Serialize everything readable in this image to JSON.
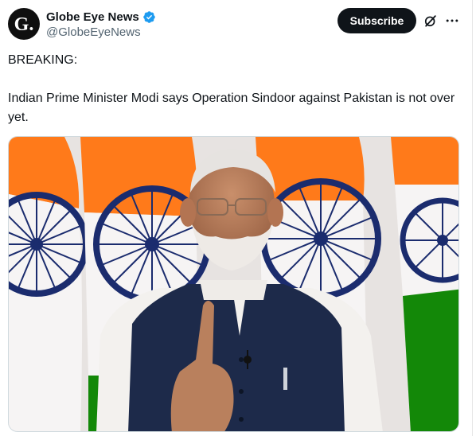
{
  "account": {
    "display_name": "Globe Eye News",
    "handle": "@GlobeEyeNews",
    "avatar_letter": "G.",
    "verified": true
  },
  "actions": {
    "subscribe_label": "Subscribe",
    "grok_icon": "grok-icon",
    "more_icon": "more-icon"
  },
  "tweet": {
    "line1": "BREAKING:",
    "line2": "Indian Prime Minister Modi says Operation Sindoor against Pakistan is not over yet."
  },
  "media": {
    "alt_subject": "photo",
    "colors": {
      "saffron": "#ff7a1a",
      "white": "#f6f4f4",
      "green": "#138808",
      "chakra": "#1b2c6e",
      "vest": "#1d2a4a"
    }
  },
  "colors": {
    "text": "#0f1419",
    "secondary": "#536471",
    "verified": "#1d9bf0",
    "button": "#0f1419"
  }
}
